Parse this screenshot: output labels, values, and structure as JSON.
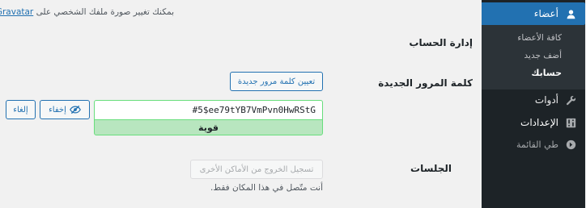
{
  "sidebar": {
    "users": {
      "label": "أعضاء",
      "icon": "user-icon"
    },
    "submenu": [
      {
        "label": "كافة الأعضاء"
      },
      {
        "label": "أضف جديد"
      },
      {
        "label": "حسابك"
      }
    ],
    "tools": {
      "label": "أدوات",
      "icon": "wrench-icon"
    },
    "settings": {
      "label": "الإعدادات",
      "icon": "settings-icon"
    },
    "collapse": {
      "label": "طي القائمة",
      "icon": "collapse-icon"
    }
  },
  "profile": {
    "gravatar_prefix": "بمكنك تغيير صورة ملفك الشخصي على",
    "gravatar_link": "Gravatar",
    "gravatar_suffix": "."
  },
  "account_management": {
    "heading": "إدارة الحساب",
    "new_password_label": "كلمة المرور الجديدة",
    "generate_button": "تعيين كلمة مرور جديدة",
    "password_value": "#5$ee79tYB7VmPvn0HwRStG",
    "strength_label": "قوية",
    "hide_button": "إخفاء",
    "cancel_button": "إلغاء"
  },
  "sessions": {
    "label": "الجلسات",
    "logout_button": "تسجيل الخروج من الأماكن الأخرى",
    "description": "أنت متّصل في هذا المكان فقط."
  },
  "colors": {
    "sidebar_bg": "#1d2327",
    "submenu_bg": "#2c3338",
    "accent": "#2271b1",
    "strong_bg": "#b8e6bf",
    "strong_border": "#68de7c"
  }
}
